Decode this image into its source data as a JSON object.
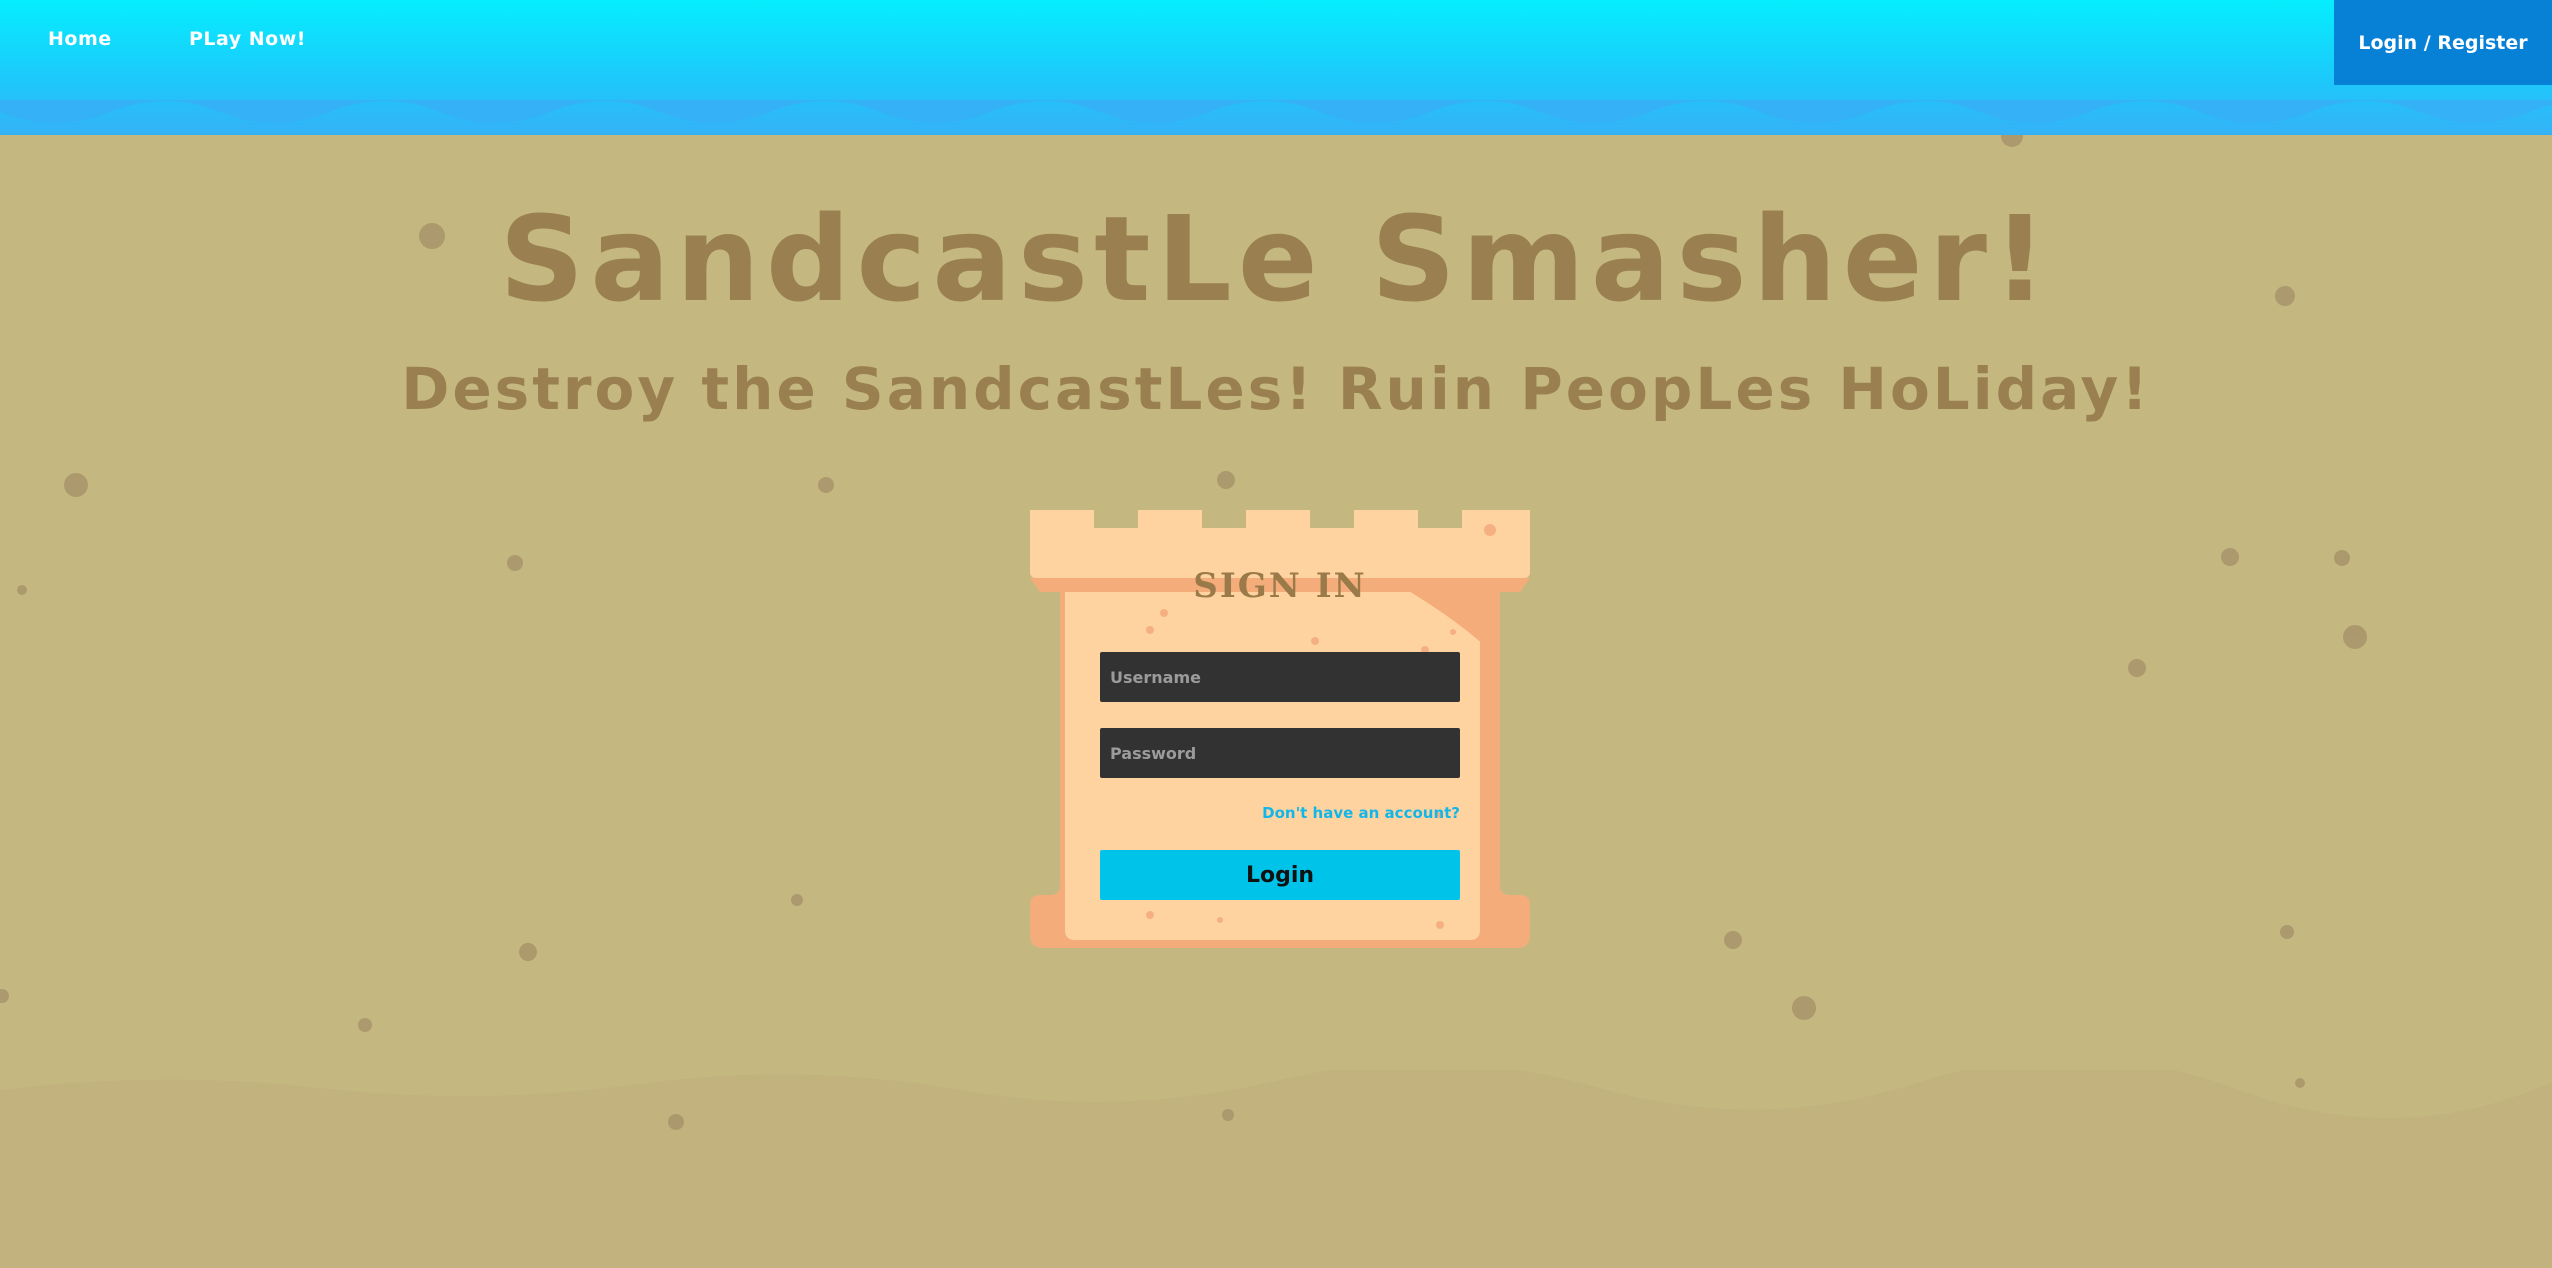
{
  "nav": {
    "home_label": "Home",
    "play_label": "PLay Now!",
    "login_register_label": "Login / Register"
  },
  "hero": {
    "title": "SandcastLe Smasher!",
    "subtitle": "Destroy the SandcastLes! Ruin PeopLes HoLiday!"
  },
  "login_form": {
    "heading": "SIGN IN",
    "username_placeholder": "Username",
    "password_placeholder": "Password",
    "register_link": "Don't have an account?",
    "submit_label": "Login"
  },
  "colors": {
    "sea_top": "#05eefe",
    "sea_bottom": "#35b2f7",
    "sand": "#c4b880",
    "accent_button": "#00c3e9",
    "nav_login_bg": "#0781d6",
    "title_color": "#9a8050"
  }
}
